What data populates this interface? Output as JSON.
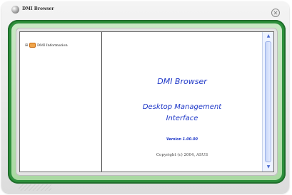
{
  "window": {
    "title": "DMI Browser"
  },
  "tree": {
    "items": [
      {
        "expander": "⊞",
        "label": "DMI Information"
      }
    ]
  },
  "detail": {
    "title": "DMI Browser",
    "subtitle_line1": "Desktop Management",
    "subtitle_line2": "Interface",
    "version": "Version 1.00.00",
    "copyright": "Copyright (c) 2004,  ASUS"
  },
  "icons": {
    "app": "disc-icon",
    "close": "close-icon",
    "tree_node": "folder-icon",
    "scroll_up": "scroll-up-arrow-icon",
    "scroll_down": "scroll-down-arrow-icon"
  },
  "colors": {
    "accent_text": "#1f38c8",
    "frame_green": "#2d8f3b"
  }
}
